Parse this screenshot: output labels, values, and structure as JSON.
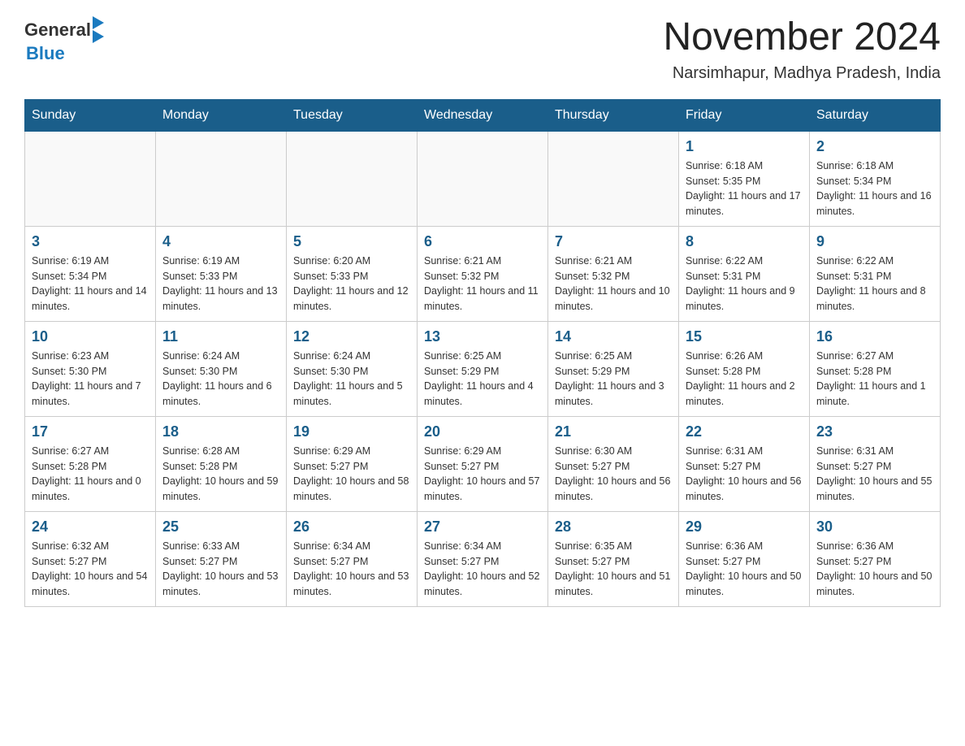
{
  "header": {
    "logo_general": "General",
    "logo_blue": "Blue",
    "title": "November 2024",
    "subtitle": "Narsimhapur, Madhya Pradesh, India"
  },
  "days_of_week": [
    "Sunday",
    "Monday",
    "Tuesday",
    "Wednesday",
    "Thursday",
    "Friday",
    "Saturday"
  ],
  "weeks": [
    {
      "days": [
        {
          "number": "",
          "info": ""
        },
        {
          "number": "",
          "info": ""
        },
        {
          "number": "",
          "info": ""
        },
        {
          "number": "",
          "info": ""
        },
        {
          "number": "",
          "info": ""
        },
        {
          "number": "1",
          "info": "Sunrise: 6:18 AM\nSunset: 5:35 PM\nDaylight: 11 hours and 17 minutes."
        },
        {
          "number": "2",
          "info": "Sunrise: 6:18 AM\nSunset: 5:34 PM\nDaylight: 11 hours and 16 minutes."
        }
      ]
    },
    {
      "days": [
        {
          "number": "3",
          "info": "Sunrise: 6:19 AM\nSunset: 5:34 PM\nDaylight: 11 hours and 14 minutes."
        },
        {
          "number": "4",
          "info": "Sunrise: 6:19 AM\nSunset: 5:33 PM\nDaylight: 11 hours and 13 minutes."
        },
        {
          "number": "5",
          "info": "Sunrise: 6:20 AM\nSunset: 5:33 PM\nDaylight: 11 hours and 12 minutes."
        },
        {
          "number": "6",
          "info": "Sunrise: 6:21 AM\nSunset: 5:32 PM\nDaylight: 11 hours and 11 minutes."
        },
        {
          "number": "7",
          "info": "Sunrise: 6:21 AM\nSunset: 5:32 PM\nDaylight: 11 hours and 10 minutes."
        },
        {
          "number": "8",
          "info": "Sunrise: 6:22 AM\nSunset: 5:31 PM\nDaylight: 11 hours and 9 minutes."
        },
        {
          "number": "9",
          "info": "Sunrise: 6:22 AM\nSunset: 5:31 PM\nDaylight: 11 hours and 8 minutes."
        }
      ]
    },
    {
      "days": [
        {
          "number": "10",
          "info": "Sunrise: 6:23 AM\nSunset: 5:30 PM\nDaylight: 11 hours and 7 minutes."
        },
        {
          "number": "11",
          "info": "Sunrise: 6:24 AM\nSunset: 5:30 PM\nDaylight: 11 hours and 6 minutes."
        },
        {
          "number": "12",
          "info": "Sunrise: 6:24 AM\nSunset: 5:30 PM\nDaylight: 11 hours and 5 minutes."
        },
        {
          "number": "13",
          "info": "Sunrise: 6:25 AM\nSunset: 5:29 PM\nDaylight: 11 hours and 4 minutes."
        },
        {
          "number": "14",
          "info": "Sunrise: 6:25 AM\nSunset: 5:29 PM\nDaylight: 11 hours and 3 minutes."
        },
        {
          "number": "15",
          "info": "Sunrise: 6:26 AM\nSunset: 5:28 PM\nDaylight: 11 hours and 2 minutes."
        },
        {
          "number": "16",
          "info": "Sunrise: 6:27 AM\nSunset: 5:28 PM\nDaylight: 11 hours and 1 minute."
        }
      ]
    },
    {
      "days": [
        {
          "number": "17",
          "info": "Sunrise: 6:27 AM\nSunset: 5:28 PM\nDaylight: 11 hours and 0 minutes."
        },
        {
          "number": "18",
          "info": "Sunrise: 6:28 AM\nSunset: 5:28 PM\nDaylight: 10 hours and 59 minutes."
        },
        {
          "number": "19",
          "info": "Sunrise: 6:29 AM\nSunset: 5:27 PM\nDaylight: 10 hours and 58 minutes."
        },
        {
          "number": "20",
          "info": "Sunrise: 6:29 AM\nSunset: 5:27 PM\nDaylight: 10 hours and 57 minutes."
        },
        {
          "number": "21",
          "info": "Sunrise: 6:30 AM\nSunset: 5:27 PM\nDaylight: 10 hours and 56 minutes."
        },
        {
          "number": "22",
          "info": "Sunrise: 6:31 AM\nSunset: 5:27 PM\nDaylight: 10 hours and 56 minutes."
        },
        {
          "number": "23",
          "info": "Sunrise: 6:31 AM\nSunset: 5:27 PM\nDaylight: 10 hours and 55 minutes."
        }
      ]
    },
    {
      "days": [
        {
          "number": "24",
          "info": "Sunrise: 6:32 AM\nSunset: 5:27 PM\nDaylight: 10 hours and 54 minutes."
        },
        {
          "number": "25",
          "info": "Sunrise: 6:33 AM\nSunset: 5:27 PM\nDaylight: 10 hours and 53 minutes."
        },
        {
          "number": "26",
          "info": "Sunrise: 6:34 AM\nSunset: 5:27 PM\nDaylight: 10 hours and 53 minutes."
        },
        {
          "number": "27",
          "info": "Sunrise: 6:34 AM\nSunset: 5:27 PM\nDaylight: 10 hours and 52 minutes."
        },
        {
          "number": "28",
          "info": "Sunrise: 6:35 AM\nSunset: 5:27 PM\nDaylight: 10 hours and 51 minutes."
        },
        {
          "number": "29",
          "info": "Sunrise: 6:36 AM\nSunset: 5:27 PM\nDaylight: 10 hours and 50 minutes."
        },
        {
          "number": "30",
          "info": "Sunrise: 6:36 AM\nSunset: 5:27 PM\nDaylight: 10 hours and 50 minutes."
        }
      ]
    }
  ]
}
